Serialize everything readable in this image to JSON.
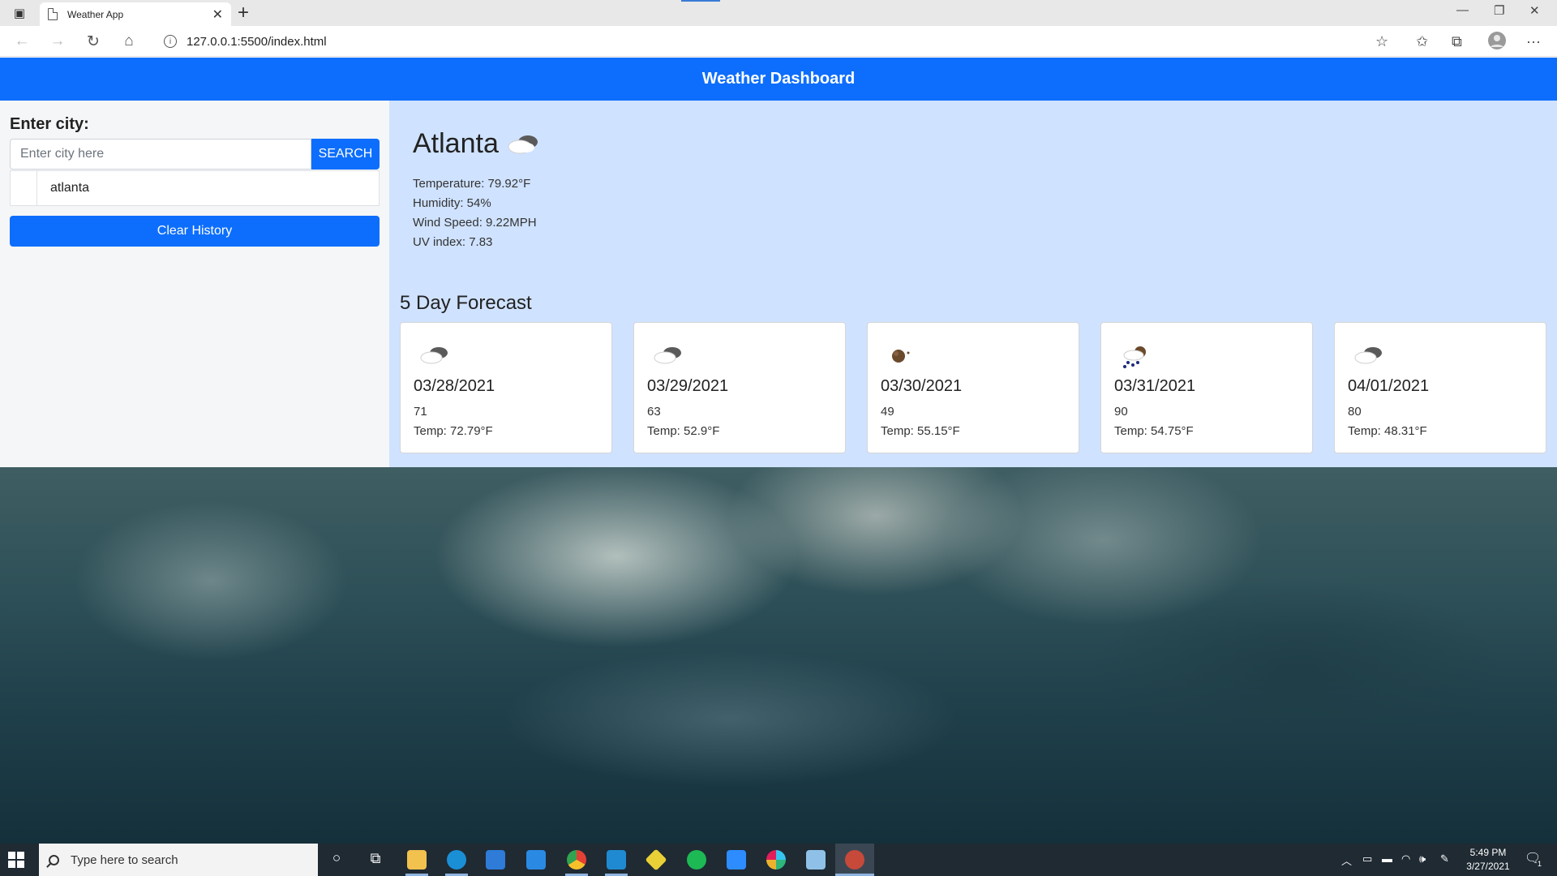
{
  "browser": {
    "tab_title": "Weather App",
    "url": "127.0.0.1:5500/index.html"
  },
  "app": {
    "header_title": "Weather Dashboard"
  },
  "sidebar": {
    "label": "Enter city:",
    "search_placeholder": "Enter city here",
    "search_button": "SEARCH",
    "history": [
      "atlanta"
    ],
    "clear_button": "Clear History"
  },
  "current": {
    "city": "Atlanta",
    "icon": "cloudy-icon",
    "temperature": "Temperature: 79.92°F",
    "humidity": "Humidity: 54%",
    "wind": "Wind Speed: 9.22MPH",
    "uv": "UV index: 7.83"
  },
  "forecast": {
    "title": "5 Day Forecast",
    "days": [
      {
        "icon": "cloudy-icon",
        "date": "03/28/2021",
        "humidity": "71",
        "temp": "Temp: 72.79°F"
      },
      {
        "icon": "cloudy-icon",
        "date": "03/29/2021",
        "humidity": "63",
        "temp": "Temp: 52.9°F"
      },
      {
        "icon": "clear-night-icon",
        "date": "03/30/2021",
        "humidity": "49",
        "temp": "Temp: 55.15°F"
      },
      {
        "icon": "rain-icon",
        "date": "03/31/2021",
        "humidity": "90",
        "temp": "Temp: 54.75°F"
      },
      {
        "icon": "cloudy-icon",
        "date": "04/01/2021",
        "humidity": "80",
        "temp": "Temp: 48.31°F"
      }
    ]
  },
  "taskbar": {
    "search_placeholder": "Type here to search",
    "time": "5:49 PM",
    "date": "3/27/2021",
    "notification_count": "1"
  },
  "colors": {
    "header": "#0d6efd",
    "main_bg": "#cfe2ff",
    "sidebar_bg": "#f5f6f7"
  }
}
